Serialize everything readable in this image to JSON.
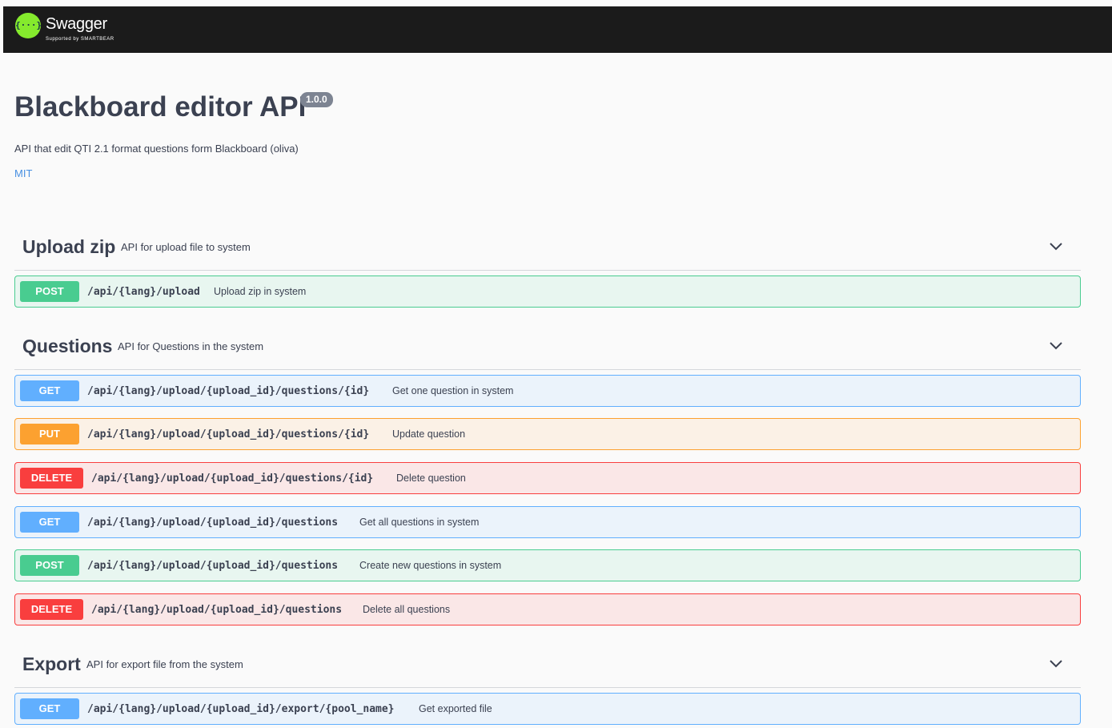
{
  "topbar": {
    "logo_glyph": "{···}",
    "brand": "Swagger",
    "supported_by": "Supported by SMARTBEAR"
  },
  "info": {
    "title": "Blackboard editor API",
    "version": "1.0.0",
    "description": "API that edit QTI 2.1 format questions form Blackboard (oliva)",
    "license": "MIT"
  },
  "tags": [
    {
      "name": "Upload zip",
      "description": "API for upload file to system",
      "operations": [
        {
          "method": "POST",
          "path": "/api/{lang}/upload",
          "summary": "Upload zip in system"
        }
      ]
    },
    {
      "name": "Questions",
      "description": "API for Questions in the system",
      "operations": [
        {
          "method": "GET",
          "path": "/api/{lang}/upload/{upload_id}/questions/{id}",
          "summary": "Get one question in system"
        },
        {
          "method": "PUT",
          "path": "/api/{lang}/upload/{upload_id}/questions/{id}",
          "summary": "Update question"
        },
        {
          "method": "DELETE",
          "path": "/api/{lang}/upload/{upload_id}/questions/{id}",
          "summary": "Delete question"
        },
        {
          "method": "GET",
          "path": "/api/{lang}/upload/{upload_id}/questions",
          "summary": "Get all questions in system"
        },
        {
          "method": "POST",
          "path": "/api/{lang}/upload/{upload_id}/questions",
          "summary": "Create new questions in system"
        },
        {
          "method": "DELETE",
          "path": "/api/{lang}/upload/{upload_id}/questions",
          "summary": "Delete all questions"
        }
      ]
    },
    {
      "name": "Export",
      "description": "API for export file from the system",
      "operations": [
        {
          "method": "GET",
          "path": "/api/{lang}/upload/{upload_id}/export/{pool_name}",
          "summary": "Get exported file"
        }
      ]
    }
  ],
  "colors": {
    "get": "#61affe",
    "post": "#49cc90",
    "put": "#fca130",
    "delete": "#f93e3e",
    "logo": "#85ea2d"
  },
  "icons": {
    "expand": "chevron-down-icon",
    "logo": "swagger-logo-icon"
  }
}
